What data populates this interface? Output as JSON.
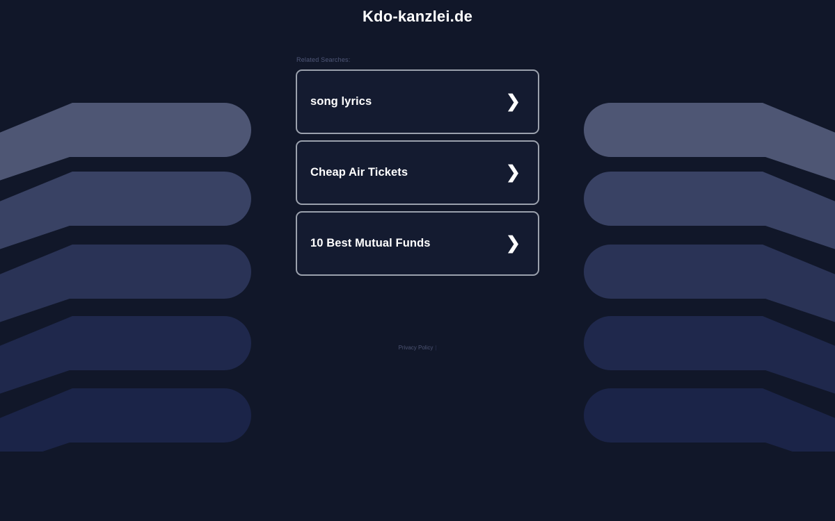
{
  "site": {
    "title": "Kdo-kanzlei.de",
    "background_color": "#111729"
  },
  "related": {
    "label": "Related Searches:",
    "items": [
      {
        "label": "song lyrics",
        "icon": "chevron-right-icon",
        "chevron": "❯"
      },
      {
        "label": "Cheap Air Tickets",
        "icon": "chevron-right-icon",
        "chevron": "❯"
      },
      {
        "label": "10 Best Mutual Funds",
        "icon": "chevron-right-icon",
        "chevron": "❯"
      }
    ],
    "card_border_color": "#9ba1ad",
    "card_background_color": "#141b30",
    "text_color": "#ffffff"
  },
  "footer": {
    "privacy_label": "Privacy Policy",
    "separator": "|",
    "text_color": "#4d5473"
  },
  "decor": {
    "bar_colors": [
      "#4e5674",
      "#394264",
      "#2a3356",
      "#1f284c",
      "#1b2448"
    ]
  }
}
